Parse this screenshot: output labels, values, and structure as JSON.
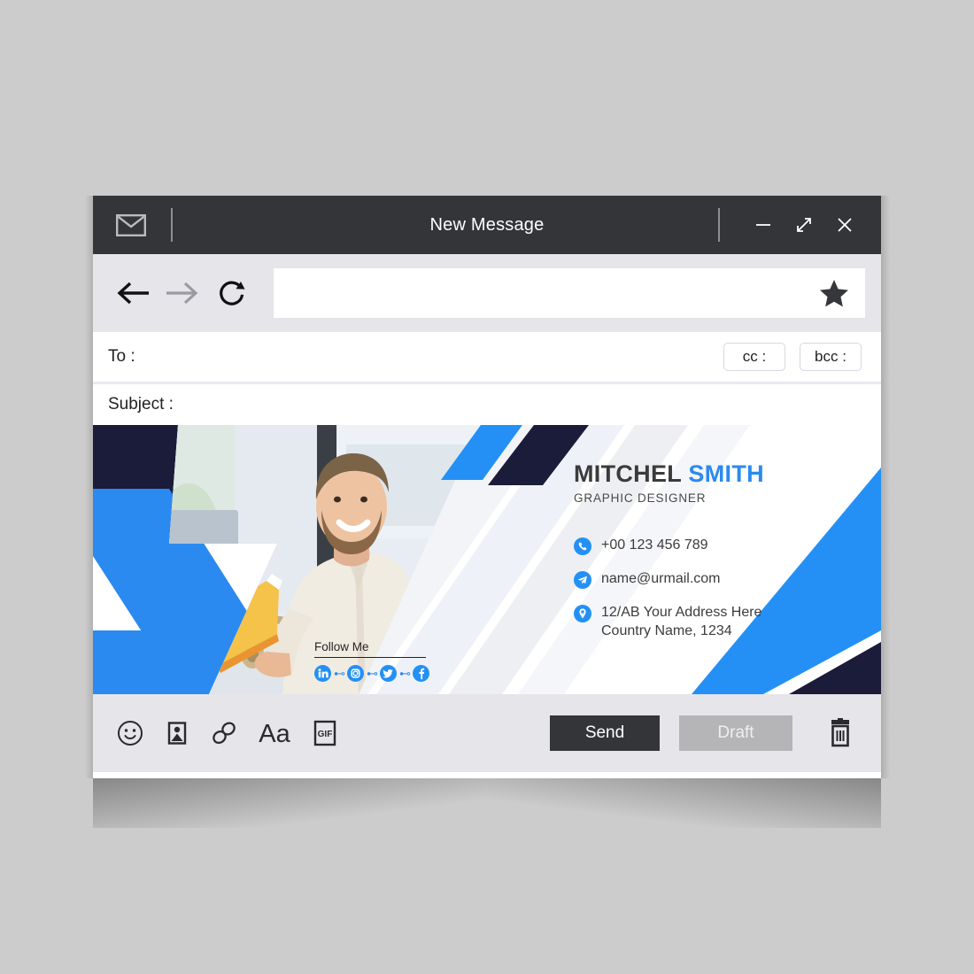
{
  "window": {
    "titlebar": {
      "app_icon": "envelope-icon",
      "title": "New Message",
      "minimize": "minimize-icon",
      "maximize": "maximize-icon",
      "close": "close-icon"
    },
    "navbar": {
      "back": "back-arrow-icon",
      "forward": "forward-arrow-icon",
      "reload": "reload-icon",
      "url_value": "",
      "url_placeholder": "",
      "bookmark": "star-icon"
    },
    "compose": {
      "to_label": "To :",
      "to_value": "",
      "to_placeholder": "",
      "cc_label": "cc :",
      "bcc_label": "bcc :",
      "subject_label": "Subject :",
      "subject_value": "",
      "subject_placeholder": ""
    },
    "toolbar": {
      "icons": [
        {
          "name": "emoji-icon",
          "label": "emoji"
        },
        {
          "name": "image-icon",
          "label": "image"
        },
        {
          "name": "link-icon",
          "label": "link"
        },
        {
          "name": "font-icon",
          "label": "Aa"
        },
        {
          "name": "gif-icon",
          "label": "GIF"
        }
      ],
      "send_label": "Send",
      "draft_label": "Draft",
      "delete_icon": "trash-icon"
    }
  },
  "signature": {
    "first_name": "MITCHEL",
    "last_name": "SMITH",
    "role": "GRAPHIC DESIGNER",
    "contacts": [
      {
        "icon": "phone-icon",
        "line1": "+00 123 456 789",
        "line2": ""
      },
      {
        "icon": "telegram-icon",
        "line1": "name@urmail.com",
        "line2": ""
      },
      {
        "icon": "location-pin-icon",
        "line1": "12/AB Your Address Here",
        "line2": "Country Name, 1234"
      }
    ],
    "follow": {
      "title": "Follow Me",
      "networks": [
        "linkedin-icon",
        "instagram-icon",
        "twitter-icon",
        "facebook-icon"
      ]
    },
    "photo_alt": "smiling-man-holding-book"
  },
  "colors": {
    "accent_blue": "#2b8aef",
    "deep_navy": "#1b1b3a",
    "titlebar_dark": "#333539",
    "chrome_gray": "#e5e5ea",
    "draft_gray": "#b5b5b8",
    "page_bg": "#cccccc"
  }
}
